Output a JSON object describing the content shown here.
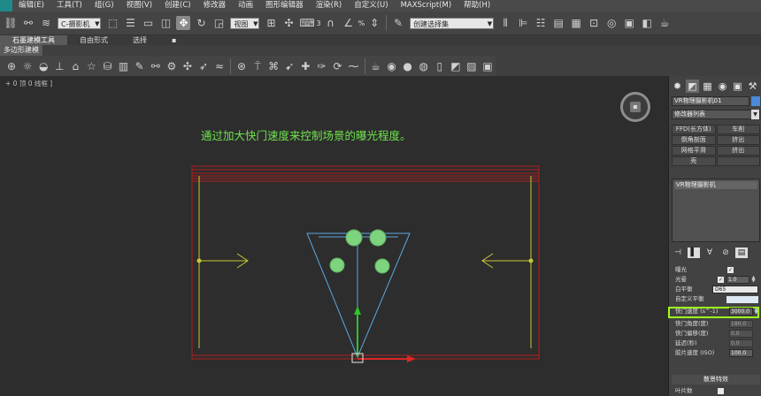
{
  "menu": {
    "items": [
      "编辑(E)",
      "工具(T)",
      "组(G)",
      "视图(V)",
      "创建(C)",
      "修改器",
      "动画",
      "图形编辑器",
      "渲染(R)",
      "自定义(U)",
      "MAXScript(M)",
      "帮助(H)"
    ]
  },
  "toolbar": {
    "filter_dropdown": "C-摄影机",
    "coord_dropdown": "视图",
    "num_label": "3",
    "percent_label": "%",
    "selection_set_dropdown": "创建选择集"
  },
  "ribbon": {
    "tabs": [
      "石墨建模工具",
      "自由形式",
      "选择"
    ],
    "panel_label": "多边形建模"
  },
  "viewport": {
    "label": "+ 0 顶 0 线框 ]",
    "annotation": "通过加大快门速度来控制场景的曝光程度。"
  },
  "command_panel": {
    "object_name": "VR物理摄影机01",
    "object_color": "#4a8ad6",
    "modifier_list": "修改器列表",
    "modifier_buttons": [
      "FFD(长方体)",
      "车削",
      "倒角剖面",
      "挤出",
      "网格平滑",
      "挤出",
      "壳",
      ""
    ],
    "stack_item": "VR物理摄影机",
    "params": {
      "exposure_label": "曝光",
      "vignetting_label": "光晕",
      "vignetting_value": "1.0",
      "white_balance_label": "白平衡",
      "white_balance_value": "D65",
      "custom_balance_label": "自定义平衡",
      "shutter_speed_label": "快门速度 (s^-1)",
      "shutter_speed_value": "3000.0",
      "shutter_angle_label": "快门角度(度)",
      "shutter_angle_value": "180.0",
      "shutter_offset_label": "快门偏移(度)",
      "shutter_offset_value": "0.0",
      "latency_label": "延迟(秒)",
      "latency_value": "0.0",
      "iso_label": "胶片速度 (ISO)",
      "iso_value": "100.0",
      "effects_header": "散景特效",
      "blades_label": "叶片数"
    }
  },
  "colors": {
    "annotation_green": "#6fe34c",
    "highlight_green": "#9cff1a",
    "wall_yellow": "#c8c83c",
    "room_red": "#b01e1e",
    "camera_blue": "#5aa8e0",
    "light_green": "#7ed37e"
  }
}
